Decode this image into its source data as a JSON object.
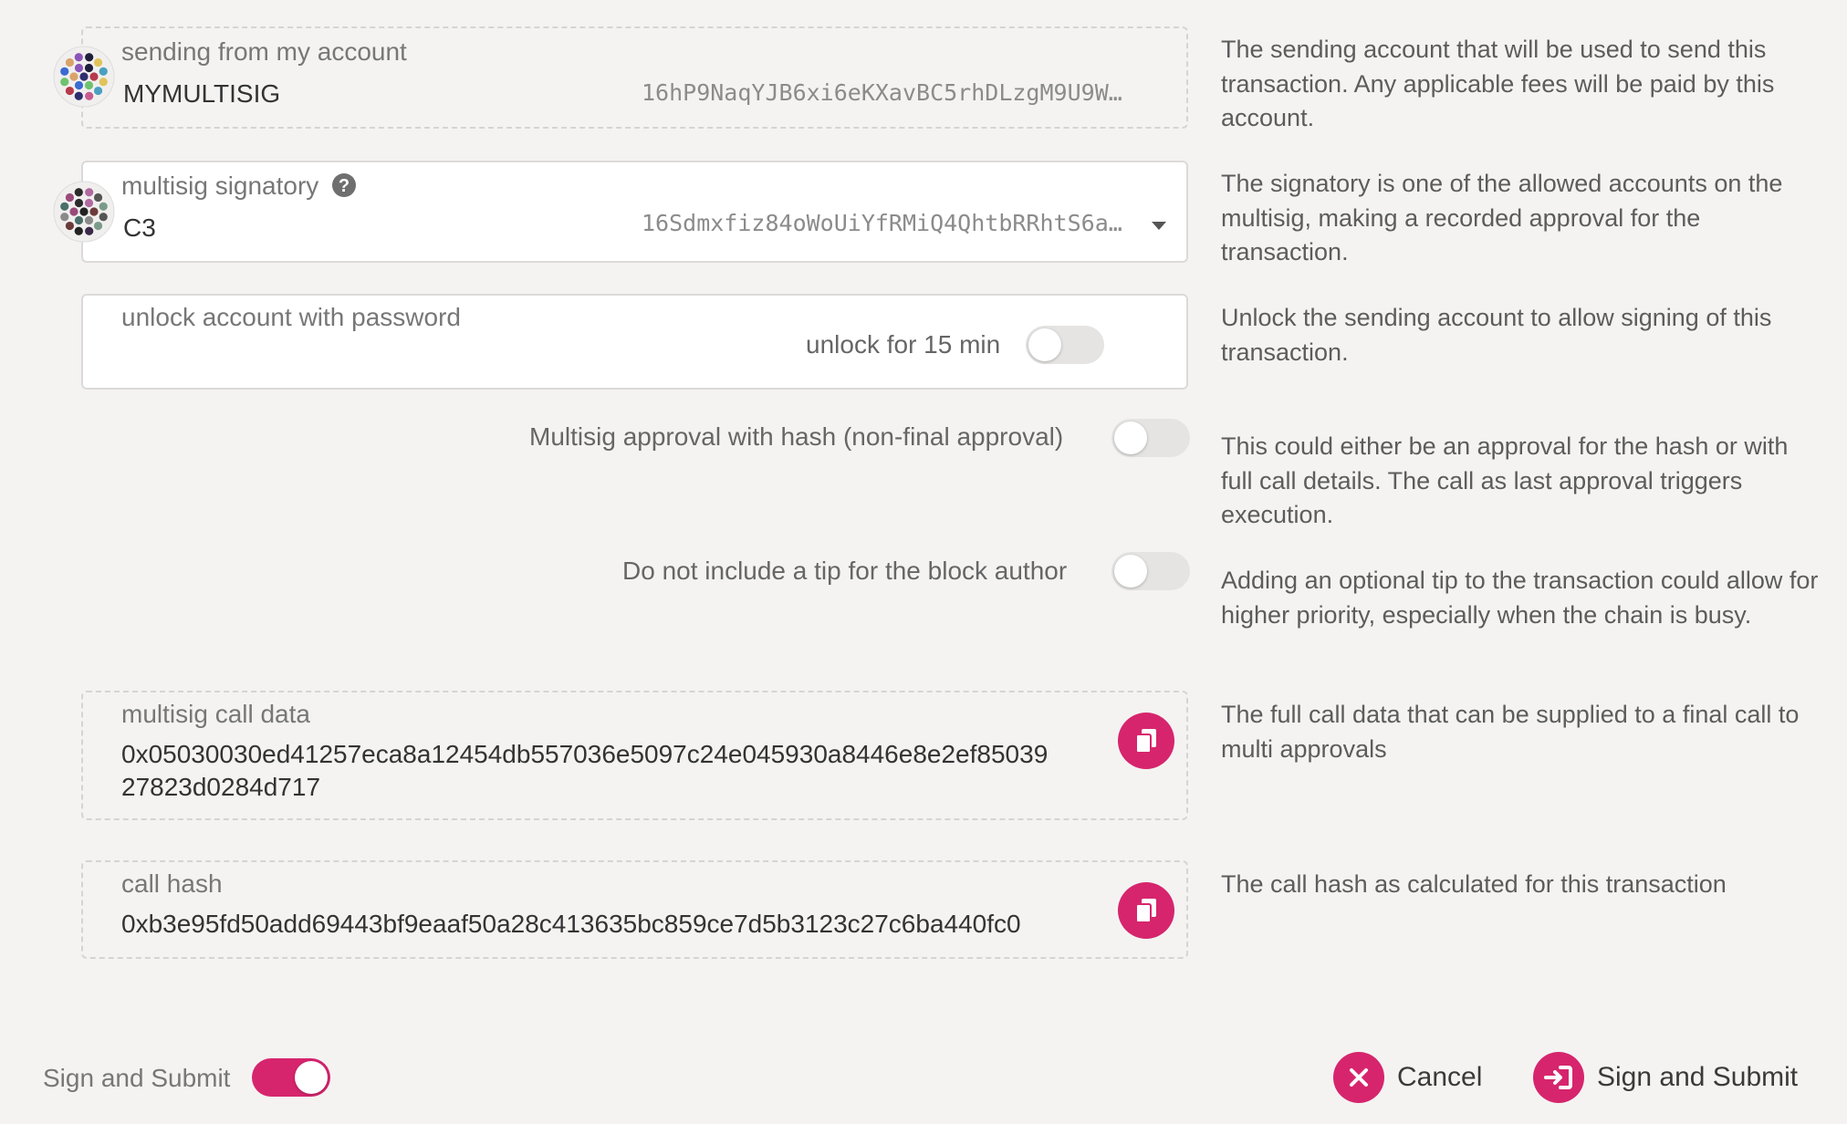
{
  "sender": {
    "label": "sending from my account",
    "name": "MYMULTISIG",
    "address": "16hP9NaqYJB6xi6eKXavBC5rhDLzgM9U9W…",
    "help": "The sending account that will be used to send this transaction. Any applicable fees will be paid by this account."
  },
  "signatory": {
    "label": "multisig signatory",
    "name": "C3",
    "address": "16Sdmxfiz84oWoUiYfRMiQ4QhtbRRhtS6a…",
    "help": "The signatory is one of the allowed accounts on the multisig, making a recorded approval for the transaction."
  },
  "unlock": {
    "label": "unlock account with password",
    "toggle_label": "unlock for 15 min",
    "help": "Unlock the sending account to allow signing of this transaction."
  },
  "approval": {
    "label": "Multisig approval with hash (non-final approval)",
    "help": "This could either be an approval for the hash or with full call details. The call as last approval triggers execution."
  },
  "tip": {
    "label": "Do not include a tip for the block author",
    "help": "Adding an optional tip to the transaction could allow for higher priority, especially when the chain is busy."
  },
  "call_data": {
    "label": "multisig call data",
    "value_line1": "0x05030030ed41257eca8a12454db557036e5097c24e045930a8446e8e2ef85039",
    "value_line2": "27823d0284d717",
    "help": "The full call data that can be supplied to a final call to multi approvals"
  },
  "call_hash": {
    "label": "call hash",
    "value": "0xb3e95fd50add69443bf9eaaf50a28c413635bc859ce7d5b3123c27c6ba440fc0",
    "help": "The call hash as calculated for this transaction"
  },
  "footer": {
    "toggle_label": "Sign and Submit",
    "cancel_label": "Cancel",
    "submit_label": "Sign and Submit"
  },
  "colors": {
    "accent": "#d6256d",
    "background": "#f4f3f2"
  }
}
